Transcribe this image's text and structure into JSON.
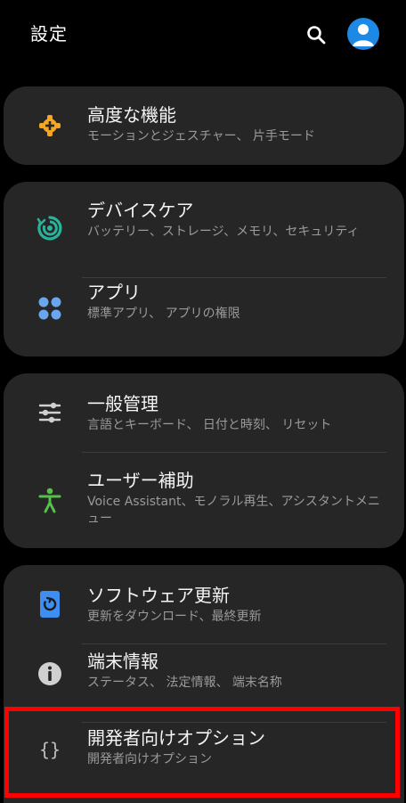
{
  "header": {
    "title": "設定",
    "icons": [
      "search-icon",
      "account-avatar-icon"
    ]
  },
  "colors": {
    "background": "#000000",
    "card": "#262626",
    "accent_blue": "#1e88e5",
    "advanced_icon": "#f5a623",
    "device_care_icon": "#2bb39a",
    "accessibility_icon": "#57c04a",
    "highlight": "#ff0000"
  },
  "sections": [
    {
      "items": [
        {
          "title": "高度な機能",
          "subtitle": "モーションとジェスチャー、 片手モード",
          "icon": "puzzle-gear-icon"
        }
      ]
    },
    {
      "items": [
        {
          "title": "デバイスケア",
          "subtitle": "バッテリー、ストレージ、メモリ、セキュリティ",
          "icon": "device-care-icon"
        },
        {
          "title": "アプリ",
          "subtitle": "標準アプリ、 アプリの権限",
          "icon": "apps-grid-icon"
        }
      ]
    },
    {
      "items": [
        {
          "title": "一般管理",
          "subtitle": "言語とキーボード、 日付と時刻、 リセット",
          "icon": "sliders-icon"
        },
        {
          "title": "ユーザー補助",
          "subtitle": "Voice Assistant、モノラル再生、アシスタントメニュー",
          "icon": "accessibility-icon"
        }
      ]
    },
    {
      "items": [
        {
          "title": "ソフトウェア更新",
          "subtitle": "更新をダウンロード、最終更新",
          "icon": "software-update-icon"
        },
        {
          "title": "端末情報",
          "subtitle": "ステータス、 法定情報、 端末名称",
          "icon": "info-icon"
        },
        {
          "title": "開発者向けオプション",
          "subtitle": "開発者向けオプション",
          "icon": "braces-icon"
        }
      ]
    }
  ]
}
